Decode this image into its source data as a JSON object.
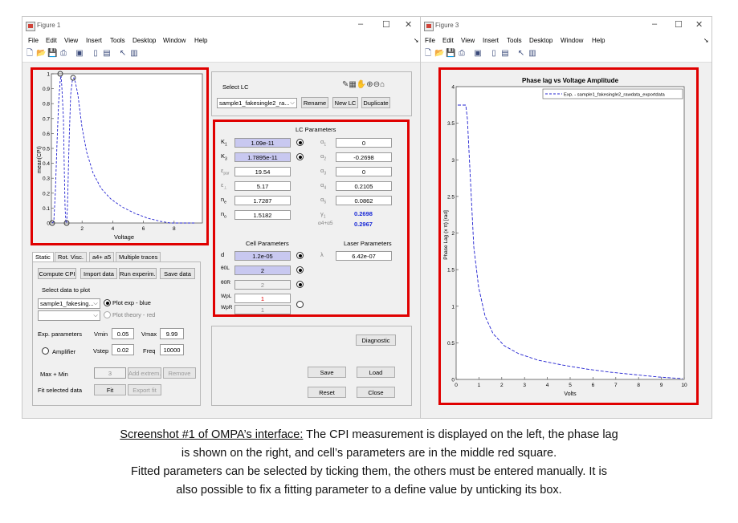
{
  "fig1": {
    "title": "Figure 1",
    "menu": [
      "File",
      "Edit",
      "View",
      "Insert",
      "Tools",
      "Desktop",
      "Window",
      "Help"
    ],
    "plot": {
      "ylabel": "mean(CPI)",
      "xlabel": "Voltage",
      "yticks": [
        "0",
        "0.1",
        "0.2",
        "0.3",
        "0.4",
        "0.5",
        "0.6",
        "0.7",
        "0.8",
        "0.9",
        "1"
      ],
      "xticks": [
        "2",
        "4",
        "6",
        "8"
      ]
    },
    "select_lc": {
      "label": "Select LC",
      "value": "sample1_fakesingle2_ra...",
      "rename": "Rename",
      "new_lc": "New LC",
      "duplicate": "Duplicate"
    },
    "lc_params": {
      "title": "LC Parameters",
      "rows": [
        {
          "label": "K",
          "sub": "1",
          "value": "1.09e-11",
          "radio": true,
          "alabel": "α",
          "asub": "1",
          "avalue": "0"
        },
        {
          "label": "K",
          "sub": "3",
          "value": "1.7895e-11",
          "radio": true,
          "alabel": "α",
          "asub": "2",
          "avalue": "-0.2698"
        },
        {
          "label": "ε",
          "sub": "par",
          "value": "19.54",
          "radio": false,
          "alabel": "α",
          "asub": "3",
          "avalue": "0"
        },
        {
          "label": "ε",
          "sub": "⊥",
          "value": "5.17",
          "radio": false,
          "alabel": "α",
          "asub": "4",
          "avalue": "0.2105"
        },
        {
          "label": "n",
          "sub": "e",
          "value": "1.7287",
          "radio": false,
          "alabel": "α",
          "asub": "5",
          "avalue": "0.0862"
        },
        {
          "label": "n",
          "sub": "o",
          "value": "1.5182",
          "radio": false,
          "alabel": "γ",
          "asub": "1",
          "avalue": "0.2698"
        }
      ],
      "a4a5_label": "α4+α5",
      "a4a5_value": "0.2967"
    },
    "cell_params": {
      "title": "Cell Parameters",
      "laser_title": "Laser Parameters",
      "rows": [
        {
          "label": "d",
          "value": "1.2e-05"
        },
        {
          "label": "θ0L",
          "value": "2"
        },
        {
          "label": "θ0R",
          "value": "2"
        },
        {
          "label": "WpL",
          "value": "1"
        },
        {
          "label": "WpR",
          "value": "1"
        }
      ],
      "lambda_label": "λ",
      "lambda_value": "6.42e-07"
    },
    "bottom_buttons": {
      "diagnostic": "Diagnostic",
      "save": "Save",
      "load": "Load",
      "reset": "Reset",
      "close": "Close"
    },
    "tabs": [
      "Static",
      "Rot. Visc.",
      "a4+ a5",
      "Multiple traces"
    ],
    "static_panel": {
      "compute_cpi": "Compute CPI",
      "import_data": "Import data",
      "run_experiment": "Run experim...",
      "save_data": "Save data",
      "select_data_label": "Select data to plot",
      "dataset": "sample1_fakesing...",
      "plot_exp": "Plot exp - blue",
      "plot_theory": "Plot theory - red",
      "exp_params_label": "Exp. parameters",
      "vmin_label": "Vmin",
      "vmin": "0.05",
      "vmax_label": "Vmax",
      "vmax": "9.99",
      "amplifier": "Amplifier",
      "vstep_label": "Vstep",
      "vstep": "0.02",
      "freq_label": "Freq",
      "freq": "10000",
      "max_min_label": "Max + Min",
      "max_min_value": "3",
      "add_extrem": "Add extrem...",
      "remove": "Remove",
      "fit_label": "Fit selected data",
      "fit": "Fit",
      "export_fit": "Export fit"
    }
  },
  "fig3": {
    "title": "Figure 3",
    "menu": [
      "File",
      "Edit",
      "View",
      "Insert",
      "Tools",
      "Desktop",
      "Window",
      "Help"
    ],
    "plot": {
      "title": "Phase lag vs Voltage Amplitude",
      "legend": "Exp. - sample1_fakesingle2_rawdata_exportdata",
      "ylabel": "Phase Lag (x π) [rad]",
      "xlabel": "Volts",
      "yticks": [
        "0",
        "0.5",
        "1",
        "1.5",
        "2",
        "2.5",
        "3",
        "3.5",
        "4"
      ],
      "xticks": [
        "0",
        "1",
        "2",
        "3",
        "4",
        "5",
        "6",
        "7",
        "8",
        "9",
        "10"
      ]
    }
  },
  "caption": {
    "underlined": "Screenshot #1 of OMPA’s interface:",
    "line1_rest": " The CPI measurement is displayed on the left, the phase lag",
    "line2": "is shown on the right, and cell’s parameters are in the middle red square.",
    "line3": "Fitted parameters can be selected by ticking them, the others must be entered manually. It is",
    "line4": "also possible to fix a fitting parameter to a define value by unticking its box."
  },
  "colors": {
    "highlight_red": "#e00000",
    "series_blue": "#2020d0",
    "selected_field": "#c8c8f0"
  }
}
